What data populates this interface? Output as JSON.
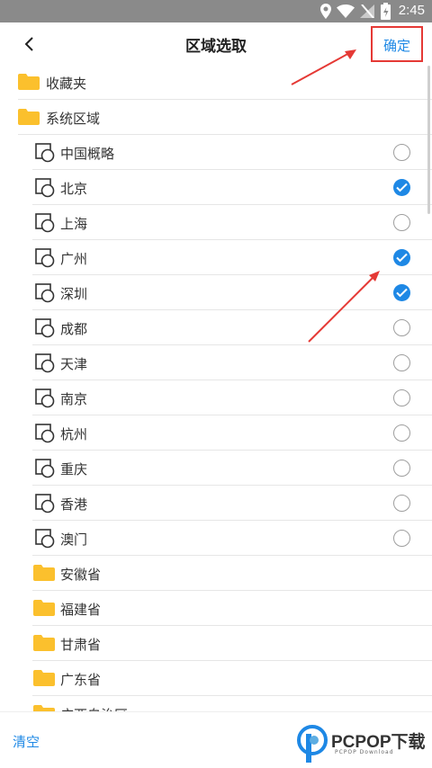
{
  "status_bar": {
    "time": "2:45"
  },
  "header": {
    "title": "区域选取",
    "confirm_label": "确定"
  },
  "list": [
    {
      "type": "folder",
      "level": 1,
      "label": "收藏夹"
    },
    {
      "type": "folder",
      "level": 1,
      "label": "系统区域"
    },
    {
      "type": "region",
      "level": 2,
      "label": "中国概略",
      "checked": false
    },
    {
      "type": "region",
      "level": 2,
      "label": "北京",
      "checked": true
    },
    {
      "type": "region",
      "level": 2,
      "label": "上海",
      "checked": false
    },
    {
      "type": "region",
      "level": 2,
      "label": "广州",
      "checked": true
    },
    {
      "type": "region",
      "level": 2,
      "label": "深圳",
      "checked": true
    },
    {
      "type": "region",
      "level": 2,
      "label": "成都",
      "checked": false
    },
    {
      "type": "region",
      "level": 2,
      "label": "天津",
      "checked": false
    },
    {
      "type": "region",
      "level": 2,
      "label": "南京",
      "checked": false
    },
    {
      "type": "region",
      "level": 2,
      "label": "杭州",
      "checked": false
    },
    {
      "type": "region",
      "level": 2,
      "label": "重庆",
      "checked": false
    },
    {
      "type": "region",
      "level": 2,
      "label": "香港",
      "checked": false
    },
    {
      "type": "region",
      "level": 2,
      "label": "澳门",
      "checked": false
    },
    {
      "type": "folder",
      "level": 2,
      "label": "安徽省"
    },
    {
      "type": "folder",
      "level": 2,
      "label": "福建省"
    },
    {
      "type": "folder",
      "level": 2,
      "label": "甘肃省"
    },
    {
      "type": "folder",
      "level": 2,
      "label": "广东省"
    },
    {
      "type": "folder",
      "level": 2,
      "label": "广西自治区"
    }
  ],
  "footer": {
    "clear_label": "清空"
  },
  "watermark": {
    "brand": "PCPOP下载",
    "sub": "PCPOP Download"
  },
  "colors": {
    "accent": "#1e88e5",
    "annotation": "#e53935",
    "folder": "#fbc02d",
    "status_bar": "#8a8a8a"
  }
}
